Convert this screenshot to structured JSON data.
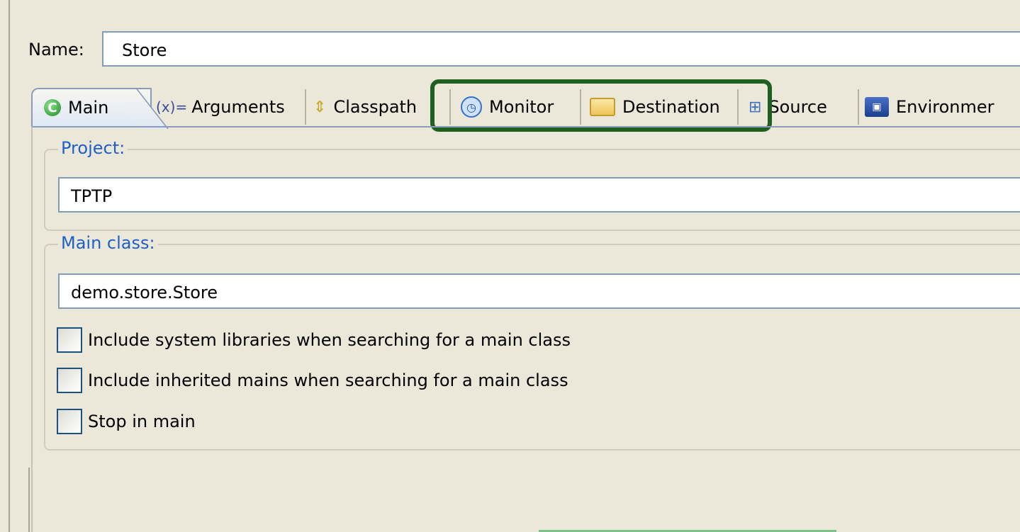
{
  "name_row": {
    "label": "Name:",
    "value": "Store"
  },
  "tabs": [
    {
      "label": "Main",
      "icon": "main-class-icon",
      "selected": true
    },
    {
      "label": "Arguments",
      "icon_text": "(x)=",
      "icon": "arguments-icon"
    },
    {
      "label": "Classpath",
      "icon": "classpath-icon"
    },
    {
      "label": "Monitor",
      "icon": "stopwatch-icon"
    },
    {
      "label": "Destination",
      "icon": "folder-icon"
    },
    {
      "label": "Source",
      "icon": "source-icon"
    },
    {
      "label": "Environmer",
      "icon": "environment-icon"
    }
  ],
  "project": {
    "title": "Project:",
    "value": "TPTP"
  },
  "main_class": {
    "title": "Main class:",
    "value": "demo.store.Store",
    "options": [
      {
        "label": "Include system libraries when searching for a main class",
        "checked": false
      },
      {
        "label": "Include inherited mains when searching for a main class",
        "checked": false
      },
      {
        "label": "Stop in main",
        "checked": false
      }
    ]
  },
  "colors": {
    "highlight": "#1f6020",
    "group_title": "#1f5fc9",
    "background": "#ebe8d9"
  }
}
